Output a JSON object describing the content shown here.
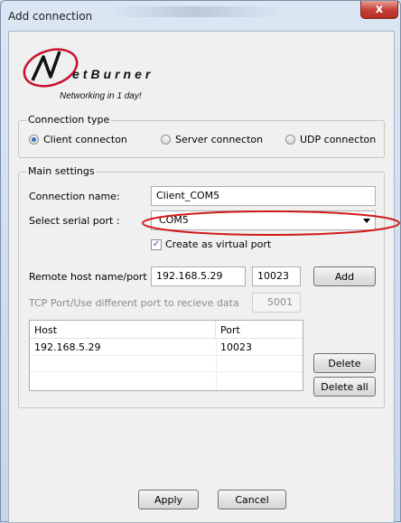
{
  "window": {
    "title": "Add connection",
    "close_glyph": "x"
  },
  "logo": {
    "text": "etBurner",
    "tagline": "Networking in 1 day!"
  },
  "connection_type": {
    "label": "Connection type",
    "options": [
      {
        "label": "Client connecton",
        "selected": true
      },
      {
        "label": "Server connecton",
        "selected": false
      },
      {
        "label": "UDP connecton",
        "selected": false
      }
    ]
  },
  "main_settings": {
    "label": "Main settings",
    "connection_name_label": "Connection name:",
    "connection_name_value": "Client_COM5",
    "serial_port_label": "Select serial port :",
    "serial_port_value": "COM5",
    "virtual_port_label": "Create as virtual port",
    "virtual_port_checked": true,
    "remote_host_label": "Remote host name/port",
    "remote_host_value": "192.168.5.29",
    "remote_port_value": "10023",
    "add_button": "Add",
    "tcp_port_label": "TCP Port/Use different port to recieve data",
    "tcp_port_value": "5001",
    "table": {
      "columns": [
        "Host",
        "Port"
      ],
      "rows": [
        {
          "host": "192.168.5.29",
          "port": "10023"
        }
      ]
    },
    "delete_button": "Delete",
    "delete_all_button": "Delete all"
  },
  "footer": {
    "apply_button": "Apply",
    "cancel_button": "Cancel"
  },
  "colors": {
    "highlight_ellipse": "#d11a1a",
    "logo_red": "#c8102e"
  }
}
